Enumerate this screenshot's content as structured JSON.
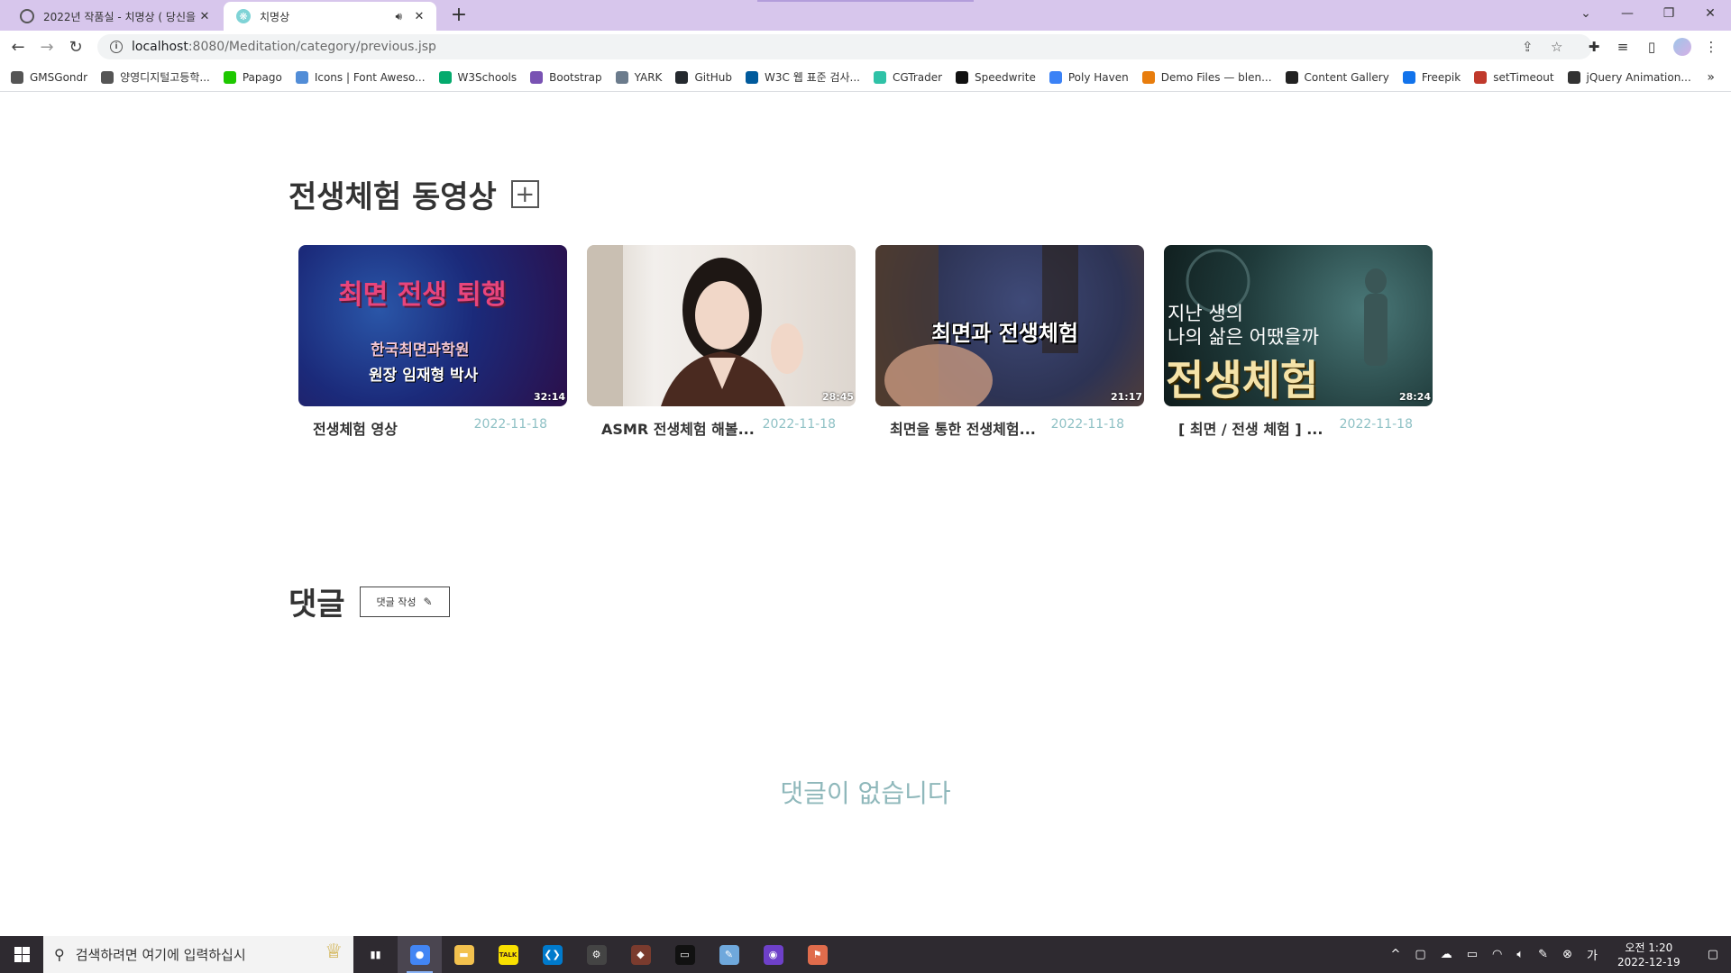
{
  "browser": {
    "tabs": [
      {
        "title": "2022년 작품실 - 치명상 ( 당신을",
        "active": false
      },
      {
        "title": "치명상",
        "active": true
      }
    ],
    "new_tab": "+",
    "url_host": "localhost",
    "url_path": ":8080/Meditation/category/previous.jsp",
    "bookmarks": [
      {
        "label": "GMSGondr",
        "color": "#555555",
        "icon": "globe-icon"
      },
      {
        "label": "양영디지털고등학...",
        "color": "#555555",
        "icon": "globe-icon"
      },
      {
        "label": "Papago",
        "color": "#1ec800",
        "icon": "papago-icon"
      },
      {
        "label": "Icons | Font Aweso...",
        "color": "#528dd7",
        "icon": "flag-icon"
      },
      {
        "label": "W3Schools",
        "color": "#04aa6d",
        "icon": "w3schools-icon"
      },
      {
        "label": "Bootstrap",
        "color": "#7952b3",
        "icon": "bootstrap-icon"
      },
      {
        "label": "YARK",
        "color": "#6b7b8c",
        "icon": "yark-icon"
      },
      {
        "label": "GitHub",
        "color": "#24292e",
        "icon": "github-icon"
      },
      {
        "label": "W3C 웹 표준 검사...",
        "color": "#005a9c",
        "icon": "w3c-icon"
      },
      {
        "label": "CGTrader",
        "color": "#2fc2a7",
        "icon": "cgtrader-icon"
      },
      {
        "label": "Speedwrite",
        "color": "#111111",
        "icon": "speedwrite-icon"
      },
      {
        "label": "Poly Haven",
        "color": "#3b82f6",
        "icon": "polyhaven-icon"
      },
      {
        "label": "Demo Files — blen...",
        "color": "#e87d0d",
        "icon": "blender-icon"
      },
      {
        "label": "Content Gallery",
        "color": "#222222",
        "icon": "content-gallery-icon"
      },
      {
        "label": "Freepik",
        "color": "#1273eb",
        "icon": "freepik-icon"
      },
      {
        "label": "setTimeout",
        "color": "#c0392b",
        "icon": "settimeout-icon"
      },
      {
        "label": "jQuery Animation...",
        "color": "#333333",
        "icon": "jquery-icon"
      }
    ],
    "bookmarks_more": "»"
  },
  "page": {
    "section_title": "전생체험 동영상",
    "add_label": "+",
    "videos": [
      {
        "title": "전생체험 영상",
        "date": "2022-11-18",
        "duration": "32:14",
        "thumb_lines": [
          "최면 전생 퇴행",
          "한국최면과학원",
          "원장 임재형 박사"
        ],
        "bg": "#1b2a7a"
      },
      {
        "title": "ASMR 전생체험 해볼...",
        "date": "2022-11-18",
        "duration": "28:45",
        "thumb_lines": [],
        "bg": "#e9e5e2"
      },
      {
        "title": "최면을 통한 전생체험...",
        "date": "2022-11-18",
        "duration": "21:17",
        "thumb_lines": [
          "최면과 전생체험"
        ],
        "bg": "#2d3354"
      },
      {
        "title": "[ 최면 / 전생 체험 ] ...",
        "date": "2022-11-18",
        "duration": "28:24",
        "thumb_lines": [
          "지난 생의",
          "나의 삶은 어땠을까",
          "전생체험"
        ],
        "bg": "#1f3a3a"
      }
    ],
    "comments_title": "댓글",
    "comment_button": "댓글 작성",
    "empty_message": "댓글이 없습니다"
  },
  "taskbar": {
    "search_placeholder": "검색하려면 여기에 입력하십시",
    "time": "오전 1:20",
    "date": "2022-12-19",
    "apps": [
      {
        "name": "task-view",
        "color": "#2e2a30",
        "glyph": "▮▮"
      },
      {
        "name": "chrome",
        "color": "#4285f4",
        "glyph": "●",
        "active": true
      },
      {
        "name": "file-explorer",
        "color": "#f2c14e",
        "glyph": "▬"
      },
      {
        "name": "kakaotalk",
        "color": "#f9e000",
        "glyph": "TALK"
      },
      {
        "name": "vscode",
        "color": "#007acc",
        "glyph": "❮❯"
      },
      {
        "name": "settings",
        "color": "#444444",
        "glyph": "⚙"
      },
      {
        "name": "game",
        "color": "#7a3b2e",
        "glyph": "◆"
      },
      {
        "name": "terminal",
        "color": "#111111",
        "glyph": "▭"
      },
      {
        "name": "notepad",
        "color": "#6fa8dc",
        "glyph": "✎"
      },
      {
        "name": "github-desktop",
        "color": "#6e40c9",
        "glyph": "◉"
      },
      {
        "name": "other-app",
        "color": "#e06c4c",
        "glyph": "⚑"
      }
    ]
  }
}
